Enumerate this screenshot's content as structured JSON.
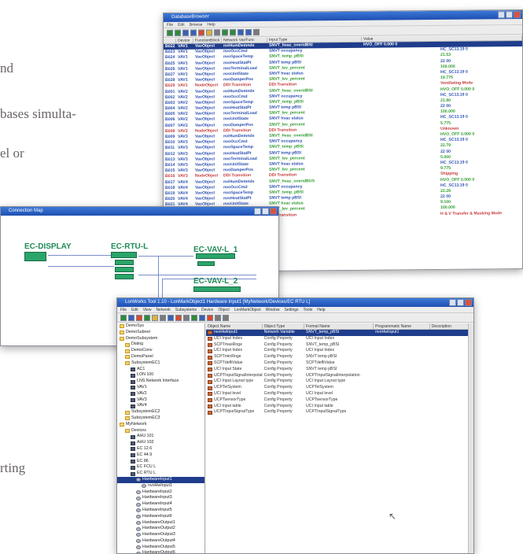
{
  "page_text": {
    "fragments": [
      "nd",
      "bases simulta-",
      "el or",
      "rting"
    ]
  },
  "db_window": {
    "title": "DatabaseBrowser",
    "menu": [
      "File",
      "Edit",
      "Browse",
      "Help"
    ],
    "columns": [
      "Device",
      "FunctionBlock",
      "Network Var/Func",
      "Input Type",
      "Value"
    ],
    "rows": [
      {
        "id": "B022",
        "device": "VAV1",
        "fb": "VavObject",
        "nv": "nviHumDemnds",
        "type": "SNVT_hvac_overidBSI",
        "value": "HVO_OFF 0.000 0",
        "style": "sel"
      },
      {
        "id": "B023",
        "device": "VAV1",
        "fb": "VavObject",
        "nv": "nvoOccCmd",
        "type": "SNVT occupancy",
        "value": "HC_SC13.19 0",
        "style": "norm"
      },
      {
        "id": "B024",
        "device": "VAV1",
        "fb": "VavObject",
        "nv": "nvoSpaceTemp",
        "type": "SNVT_temp_pBSI",
        "value": "21.53",
        "style": "grn"
      },
      {
        "id": "B025",
        "device": "VAV1",
        "fb": "VavObject",
        "nv": "nvoHeatStatPt",
        "type": "SNVT temp pBSI",
        "value": "22 00",
        "style": "norm"
      },
      {
        "id": "B026",
        "device": "VAV1",
        "fb": "VavObject",
        "nv": "nvoTerminalLoad",
        "type": "SNVT_lev_percent",
        "value": "100.000",
        "style": "grn"
      },
      {
        "id": "B027",
        "device": "VAV1",
        "fb": "VavObject",
        "nv": "nvoUnitState",
        "type": "SNVT hvac status",
        "value": "HC_SC13.19 0",
        "style": "norm"
      },
      {
        "id": "B028",
        "device": "VAV1",
        "fb": "VavObject",
        "nv": "nvoDamperPos",
        "type": "SNVT_lev_percent",
        "value": "19.775",
        "style": "grn"
      },
      {
        "id": "B029",
        "device": "VAV1",
        "fb": "NodeObject",
        "nv": "DDI Transition",
        "type": "DDI Transition",
        "value": "Ventilating Mode",
        "style": "red"
      },
      {
        "id": "B001",
        "device": "VAV2",
        "fb": "VavObject",
        "nv": "nviHumDemnds",
        "type": "SNVT_hvac_overidBSI",
        "value": "HVO_OFF 0.000 0",
        "style": "grn"
      },
      {
        "id": "B002",
        "device": "VAV2",
        "fb": "VavObject",
        "nv": "nvoOccCmd",
        "type": "SNVT occupancy",
        "value": "HC_SC13.19 0",
        "style": "norm"
      },
      {
        "id": "B003",
        "device": "VAV2",
        "fb": "VavObject",
        "nv": "nvoSpaceTemp",
        "type": "SNVT_temp_pBSI",
        "value": "21.80",
        "style": "grn"
      },
      {
        "id": "B004",
        "device": "VAV2",
        "fb": "VavObject",
        "nv": "nvoHeatStatPt",
        "type": "SNVT temp pBSI",
        "value": "22 00",
        "style": "norm"
      },
      {
        "id": "B005",
        "device": "VAV2",
        "fb": "VavObject",
        "nv": "nvoTerminalLoad",
        "type": "SNVT_lev_percent",
        "value": "100.000",
        "style": "grn"
      },
      {
        "id": "B006",
        "device": "VAV2",
        "fb": "VavObject",
        "nv": "nvoUnitState",
        "type": "SNVT hvac status",
        "value": "HC_SC13.19 0",
        "style": "norm"
      },
      {
        "id": "B007",
        "device": "VAV2",
        "fb": "VavObject",
        "nv": "nvoDamperPos",
        "type": "SNVT_lev_percent",
        "value": "5.775",
        "style": "grn"
      },
      {
        "id": "B008",
        "device": "VAV2",
        "fb": "NodeObject",
        "nv": "DDI Transition",
        "type": "DDI Transition",
        "value": "Unknown",
        "style": "red"
      },
      {
        "id": "B009",
        "device": "VAV3",
        "fb": "VavObject",
        "nv": "nviHumDemnds",
        "type": "SNVT_hvac_overidBSI",
        "value": "HVO_OFF 0.000 0",
        "style": "grn"
      },
      {
        "id": "B010",
        "device": "VAV3",
        "fb": "VavObject",
        "nv": "nvoOccCmd",
        "type": "SNVT occupancy",
        "value": "HC_SC13.19 0",
        "style": "norm"
      },
      {
        "id": "B011",
        "device": "VAV3",
        "fb": "VavObject",
        "nv": "nvoSpaceTemp",
        "type": "SNVT_temp_pBSI",
        "value": "22.79",
        "style": "grn"
      },
      {
        "id": "B012",
        "device": "VAV3",
        "fb": "VavObject",
        "nv": "nvoHeatStatPt",
        "type": "SNVT temp pBSI",
        "value": "22 00",
        "style": "norm"
      },
      {
        "id": "B013",
        "device": "VAV3",
        "fb": "VavObject",
        "nv": "nvoTerminalLoad",
        "type": "SNVT_lev_percent",
        "value": "5.000",
        "style": "grn"
      },
      {
        "id": "B014",
        "device": "VAV3",
        "fb": "VavObject",
        "nv": "nvoUnitState",
        "type": "SNVT hvac status",
        "value": "HC_SC13.19 0",
        "style": "norm"
      },
      {
        "id": "B015",
        "device": "VAV3",
        "fb": "VavObject",
        "nv": "nvoDamperPos",
        "type": "SNVT_lev_percent",
        "value": "9.775",
        "style": "grn"
      },
      {
        "id": "B016",
        "device": "VAV3",
        "fb": "NodeObject",
        "nv": "DDI Transition",
        "type": "DDI Transition",
        "value": "Shipping",
        "style": "red"
      },
      {
        "id": "B017",
        "device": "VAV4",
        "fb": "VavObject",
        "nv": "nviHumDemnds",
        "type": "SNVT_hvac_overidBUS",
        "value": "HVO_OFF 0.000 0",
        "style": "grn"
      },
      {
        "id": "B018",
        "device": "VAV4",
        "fb": "VavObject",
        "nv": "nvoOccCmd",
        "type": "SNVT occupancy",
        "value": "HC_SC13.19 0",
        "style": "norm"
      },
      {
        "id": "B019",
        "device": "VAV4",
        "fb": "VavObject",
        "nv": "nvoSpaceTemp",
        "type": "SNVT_temp_pBSI",
        "value": "22.28",
        "style": "grn"
      },
      {
        "id": "B020",
        "device": "VAV4",
        "fb": "VavObject",
        "nv": "nvoHeatStatPt",
        "type": "SNVT temp pBSI",
        "value": "22 00",
        "style": "norm"
      },
      {
        "id": "B021",
        "device": "VAV4",
        "fb": "VavObject",
        "nv": "nvoUnitState",
        "type": "SNVT hvac status",
        "value": "9.100",
        "style": "grn"
      },
      {
        "id": "B030",
        "device": "VAV4",
        "fb": "VavObject",
        "nv": "nvoDamperPos",
        "type": "SNVT_lev_percent",
        "value": "100.000",
        "style": "grn"
      },
      {
        "id": "B031",
        "device": "VAV4",
        "fb": "NodeObject",
        "nv": "DDI Transition",
        "type": "DDI Transition",
        "value": "H & V Transfer & Masking Mode",
        "style": "red"
      }
    ]
  },
  "map_window": {
    "title": "Connection Map",
    "blocks": [
      "EC-DISPLAY",
      "EC-RTU-L",
      "EC-VAV-L_1",
      "EC-VAV-L_2"
    ]
  },
  "bench_window": {
    "title": "LonWorks Tool 1.10 - LonMarkObject1 Hardware Input1 [MyNetwork/Devices/EC RTU L]",
    "menu": [
      "File",
      "Edit",
      "View",
      "Network",
      "Subsystems",
      "Device",
      "Object",
      "LonMarkObject",
      "Window",
      "Settings",
      "Tools",
      "Help"
    ],
    "tree": [
      {
        "label": "DemoSys",
        "depth": 0,
        "icon": "fold"
      },
      {
        "label": "DemoSubnet",
        "depth": 0,
        "icon": "fold"
      },
      {
        "label": "DemoSubsystem",
        "depth": 0,
        "icon": "fold"
      },
      {
        "label": "Dialog",
        "depth": 1,
        "icon": "fold"
      },
      {
        "label": "DemoConv",
        "depth": 1,
        "icon": "fold"
      },
      {
        "label": "DemoPanel",
        "depth": 1,
        "icon": "fold"
      },
      {
        "label": "SubsystemEC1",
        "depth": 1,
        "icon": "fold"
      },
      {
        "label": "AC1",
        "depth": 2,
        "icon": "dev"
      },
      {
        "label": "LON 100",
        "depth": 2,
        "icon": "dev"
      },
      {
        "label": "LNS Network Interface",
        "depth": 2,
        "icon": "dev"
      },
      {
        "label": "VAV1",
        "depth": 2,
        "icon": "dev"
      },
      {
        "label": "VAV2",
        "depth": 2,
        "icon": "dev"
      },
      {
        "label": "VAV3",
        "depth": 2,
        "icon": "dev"
      },
      {
        "label": "VAV4",
        "depth": 2,
        "icon": "dev"
      },
      {
        "label": "SubsystemEC2",
        "depth": 1,
        "icon": "fold"
      },
      {
        "label": "SubsystemEC3",
        "depth": 1,
        "icon": "fold"
      },
      {
        "label": "MyNetwork",
        "depth": 0,
        "icon": "fold"
      },
      {
        "label": "Devices",
        "depth": 1,
        "icon": "fold"
      },
      {
        "label": "AHU 101",
        "depth": 2,
        "icon": "dev"
      },
      {
        "label": "AHU 102",
        "depth": 2,
        "icon": "dev"
      },
      {
        "label": "EC 12.6",
        "depth": 2,
        "icon": "dev"
      },
      {
        "label": "EC 44.9",
        "depth": 2,
        "icon": "dev"
      },
      {
        "label": "EC 86",
        "depth": 2,
        "icon": "dev"
      },
      {
        "label": "EC FCU L",
        "depth": 2,
        "icon": "dev"
      },
      {
        "label": "EC RTU L",
        "depth": 2,
        "icon": "dev"
      },
      {
        "label": "HardwareInput1",
        "depth": 3,
        "icon": "gear",
        "sel": true
      },
      {
        "label": "nvoHwInput1",
        "depth": 4,
        "icon": "gear"
      },
      {
        "label": "HardwareInput2",
        "depth": 3,
        "icon": "gear"
      },
      {
        "label": "HardwareInput3",
        "depth": 3,
        "icon": "gear"
      },
      {
        "label": "HardwareInput4",
        "depth": 3,
        "icon": "gear"
      },
      {
        "label": "HardwareInput5",
        "depth": 3,
        "icon": "gear"
      },
      {
        "label": "HardwareInput6",
        "depth": 3,
        "icon": "gear"
      },
      {
        "label": "HardwareOutput1",
        "depth": 3,
        "icon": "gear"
      },
      {
        "label": "HardwareOutput2",
        "depth": 3,
        "icon": "gear"
      },
      {
        "label": "HardwareOutput3",
        "depth": 3,
        "icon": "gear"
      },
      {
        "label": "HardwareOutput4",
        "depth": 3,
        "icon": "gear"
      },
      {
        "label": "HardwareOutput5",
        "depth": 3,
        "icon": "gear"
      },
      {
        "label": "HardwareOutput6",
        "depth": 3,
        "icon": "gear"
      },
      {
        "label": "HardwareOutput7",
        "depth": 3,
        "icon": "gear"
      },
      {
        "label": "NodeDiagObject",
        "depth": 3,
        "icon": "gear"
      },
      {
        "label": "NodeObject",
        "depth": 3,
        "icon": "gear"
      }
    ],
    "columns": [
      "Object Name",
      "Object Type",
      "Format Name",
      "Programmatic Name",
      "Description"
    ],
    "rows": [
      {
        "name": "nvoHwInput1",
        "type": "Network Variable",
        "format": "SNVT_temp_pBSI",
        "prog": "nvoHwInput1",
        "desc": "",
        "sel": true
      },
      {
        "name": "UCI Input Index",
        "type": "Config Property",
        "format": "UCI Input Index",
        "prog": "",
        "desc": ""
      },
      {
        "name": "SCPTmaxRnge",
        "type": "Config Property",
        "format": "SNVT_temp_pBSI",
        "prog": "",
        "desc": ""
      },
      {
        "name": "UCI Input Index",
        "type": "Config Property",
        "format": "UCI Input Index",
        "prog": "",
        "desc": ""
      },
      {
        "name": "SCPTminRnge",
        "type": "Config Property",
        "format": "SNVT temp pBSI",
        "prog": "",
        "desc": ""
      },
      {
        "name": "SCPTdefltValue",
        "type": "Config Property",
        "format": "SCPTdefltValue",
        "prog": "",
        "desc": ""
      },
      {
        "name": "UCI Input State",
        "type": "Config Property",
        "format": "SNVT temp pBSI",
        "prog": "",
        "desc": ""
      },
      {
        "name": "UCPTInputSignalInterpolation",
        "type": "Config Property",
        "format": "UCPTInputSignalInterpolation",
        "prog": "",
        "desc": ""
      },
      {
        "name": "UCI Input Layout type",
        "type": "Config Property",
        "format": "UCI Input Layout type",
        "prog": "",
        "desc": ""
      },
      {
        "name": "UCPTelSystem",
        "type": "Config Property",
        "format": "UCPTelSystem",
        "prog": "",
        "desc": ""
      },
      {
        "name": "UCI Input level",
        "type": "Config Property",
        "format": "UCI Input level",
        "prog": "",
        "desc": ""
      },
      {
        "name": "UCPTsensorType",
        "type": "Config Property",
        "format": "UCPTsensorType",
        "prog": "",
        "desc": ""
      },
      {
        "name": "UCI Input table",
        "type": "Config Property",
        "format": "UCI Input table",
        "prog": "",
        "desc": ""
      },
      {
        "name": "UCPTInputSignalType",
        "type": "Config Property",
        "format": "UCPTInputSignalType",
        "prog": "",
        "desc": ""
      }
    ]
  }
}
